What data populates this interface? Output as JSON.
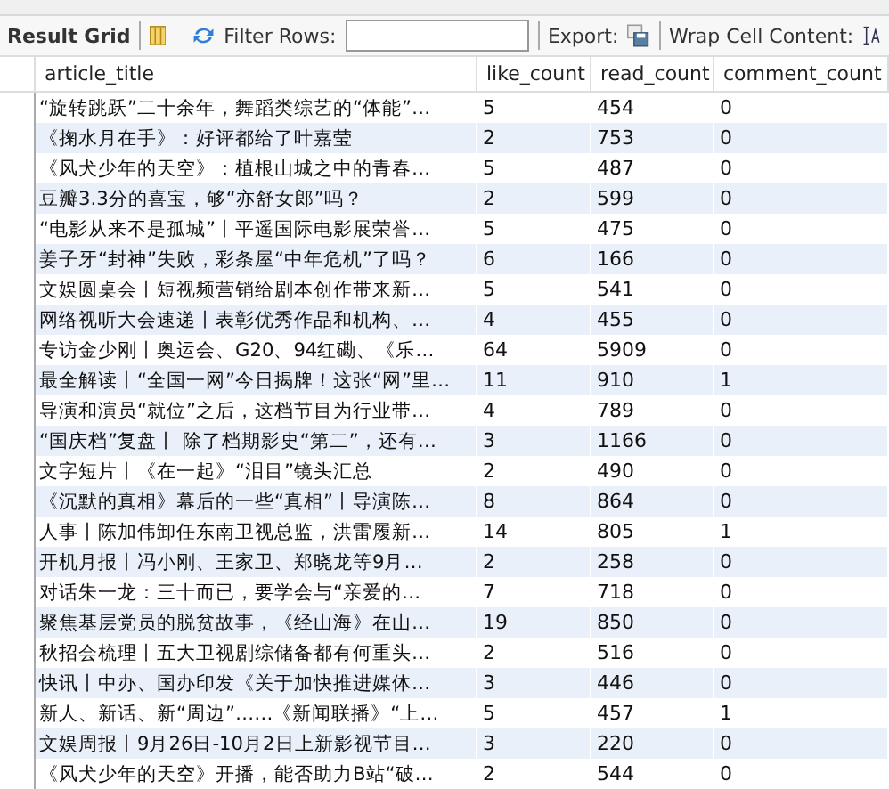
{
  "toolbar": {
    "title": "Result Grid",
    "filter_label": "Filter Rows:",
    "export_label": "Export:",
    "wrap_label": "Wrap Cell Content:"
  },
  "table": {
    "columns": [
      "article_title",
      "like_count",
      "read_count",
      "comment_count"
    ],
    "rows": [
      [
        "“旋转跳跃”二十余年，舞蹈类综艺的“体能”…",
        "5",
        "454",
        "0"
      ],
      [
        "《掬水月在手》：好评都给了叶嘉莹",
        "2",
        "753",
        "0"
      ],
      [
        "《风犬少年的天空》：植根山城之中的青春…",
        "5",
        "487",
        "0"
      ],
      [
        "豆瓣3.3分的喜宝，够“亦舒女郎”吗？",
        "2",
        "599",
        "0"
      ],
      [
        "“电影从来不是孤城”丨平遥国际电影展荣誉…",
        "5",
        "475",
        "0"
      ],
      [
        "姜子牙“封神”失败，彩条屋“中年危机”了吗？",
        "6",
        "166",
        "0"
      ],
      [
        "文娱圆桌会丨短视频营销给剧本创作带来新…",
        "5",
        "541",
        "0"
      ],
      [
        "网络视听大会速递丨表彰优秀作品和机构、…",
        "4",
        "455",
        "0"
      ],
      [
        "专访金少刚丨奥运会、G20、94红磡、《乐…",
        "64",
        "5909",
        "0"
      ],
      [
        "最全解读丨“全国一网”今日揭牌！这张“网”里…",
        "11",
        "910",
        "1"
      ],
      [
        "导演和演员“就位”之后，这档节目为行业带…",
        "4",
        "789",
        "0"
      ],
      [
        "“国庆档”复盘丨 除了档期影史“第二”，还有…",
        "3",
        "1166",
        "0"
      ],
      [
        "文字短片丨《在一起》“泪目”镜头汇总",
        "2",
        "490",
        "0"
      ],
      [
        "《沉默的真相》幕后的一些“真相”丨导演陈…",
        "8",
        "864",
        "0"
      ],
      [
        "人事丨陈加伟卸任东南卫视总监，洪雷履新…",
        "14",
        "805",
        "1"
      ],
      [
        "开机月报丨冯小刚、王家卫、郑晓龙等9月…",
        "2",
        "258",
        "0"
      ],
      [
        "对话朱一龙：三十而已，要学会与“亲爱的…",
        "7",
        "718",
        "0"
      ],
      [
        "聚焦基层党员的脱贫故事，《经山海》在山…",
        "19",
        "850",
        "0"
      ],
      [
        "秋招会梳理丨五大卫视剧综储备都有何重头…",
        "2",
        "516",
        "0"
      ],
      [
        "快讯丨中办、国办印发《关于加快推进媒体…",
        "3",
        "446",
        "0"
      ],
      [
        "新人、新话、新“周边”……《新闻联播》“上…",
        "5",
        "457",
        "1"
      ],
      [
        "文娱周报丨9月26日-10月2日上新影视节目…",
        "3",
        "220",
        "0"
      ],
      [
        "《风犬少年的天空》开播，能否助力B站“破…",
        "2",
        "544",
        "0"
      ]
    ]
  }
}
